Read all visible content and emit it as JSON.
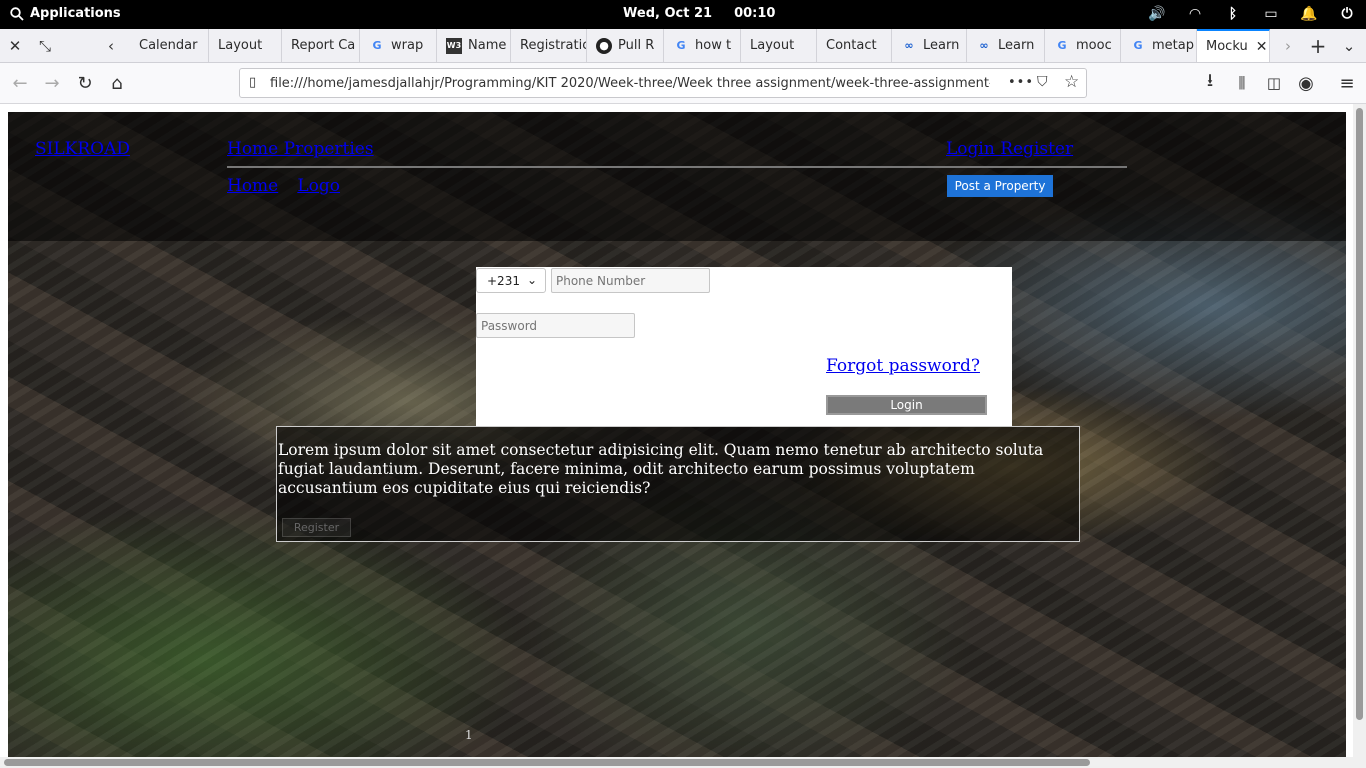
{
  "topbar": {
    "applications": "Applications",
    "date": "Wed, Oct 21",
    "time": "00:10"
  },
  "tabs": [
    {
      "label": "Calendar",
      "icon": ""
    },
    {
      "label": "Layout",
      "icon": ""
    },
    {
      "label": "Report Ca",
      "icon": ""
    },
    {
      "label": "wrap",
      "icon": "google-icon"
    },
    {
      "label": "Name",
      "icon": "w3-icon"
    },
    {
      "label": "Registratic",
      "icon": ""
    },
    {
      "label": "Pull R",
      "icon": "github-icon"
    },
    {
      "label": "how t",
      "icon": "google-icon"
    },
    {
      "label": "Layout",
      "icon": ""
    },
    {
      "label": "Contact",
      "icon": ""
    },
    {
      "label": "Learn",
      "icon": "learn-icon"
    },
    {
      "label": "Learn",
      "icon": "learn-icon"
    },
    {
      "label": "mooc",
      "icon": "google-icon"
    },
    {
      "label": "metap",
      "icon": "google-icon"
    },
    {
      "label": "Mocku",
      "icon": "",
      "active": true
    }
  ],
  "urlbar": {
    "url": "file:///home/jamesdjallahjr/Programming/KIT 2020/Week-three/Week three assignment/week-three-assignment-Jdjallahjr/Log",
    "overflow": "•••"
  },
  "site": {
    "brand": "SILKROAD",
    "nav_main": "Home Properties",
    "nav_auth": "Login Register",
    "nav_home": "Home",
    "nav_logo": "Logo",
    "post_property": "Post a Property",
    "country_code": "+231",
    "phone_placeholder": "Phone Number",
    "password_placeholder": "Password",
    "forgot": "Forgot password?",
    "login": "Login",
    "lorem": "Lorem ipsum dolor sit amet consectetur adipisicing elit. Quam nemo tenetur ab architecto soluta fugiat laudantium. Deserunt, facere minima, odit architecto earum possimus voluptatem accusantium eos cupiditate eius qui reiciendis?",
    "register": "Register",
    "page_number": "1"
  },
  "colors": {
    "accent_tab": "#0a84ff",
    "post_button": "#1e73d8",
    "link": "#0000ee"
  }
}
